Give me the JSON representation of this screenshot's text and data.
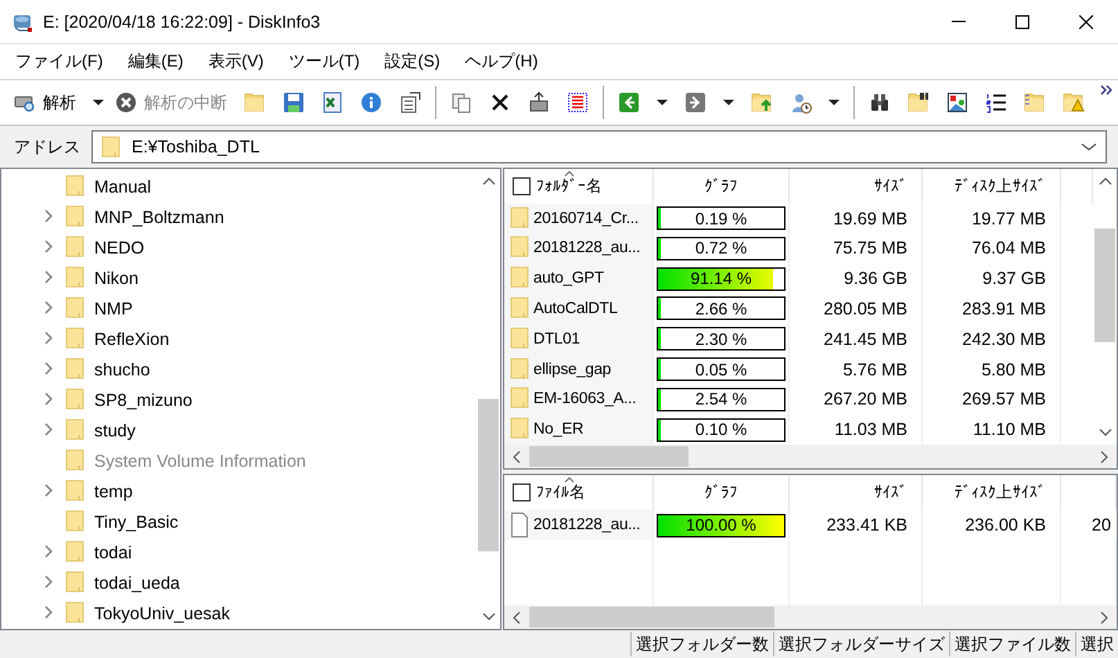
{
  "window": {
    "title": "E: [2020/04/18 16:22:09] - DiskInfo3"
  },
  "menu": [
    "ファイル(F)",
    "編集(E)",
    "表示(V)",
    "ツール(T)",
    "設定(S)",
    "ヘルプ(H)"
  ],
  "toolbar": {
    "buttons": [
      {
        "label": "解析",
        "disabled": false
      },
      {
        "label": "解析の中断",
        "disabled": true
      }
    ]
  },
  "address": {
    "label": "アドレス",
    "value": "E:¥Toshiba_DTL"
  },
  "tree": {
    "items": [
      {
        "label": "Manual",
        "expandable": false,
        "dimmed": false
      },
      {
        "label": "MNP_Boltzmann",
        "expandable": true,
        "dimmed": false
      },
      {
        "label": "NEDO",
        "expandable": true,
        "dimmed": false
      },
      {
        "label": "Nikon",
        "expandable": true,
        "dimmed": false
      },
      {
        "label": "NMP",
        "expandable": true,
        "dimmed": false
      },
      {
        "label": "RefleXion",
        "expandable": true,
        "dimmed": false
      },
      {
        "label": "shucho",
        "expandable": true,
        "dimmed": false
      },
      {
        "label": "SP8_mizuno",
        "expandable": true,
        "dimmed": false
      },
      {
        "label": "study",
        "expandable": true,
        "dimmed": false
      },
      {
        "label": "System Volume Information",
        "expandable": false,
        "dimmed": true
      },
      {
        "label": "temp",
        "expandable": true,
        "dimmed": false
      },
      {
        "label": "Tiny_Basic",
        "expandable": false,
        "dimmed": false
      },
      {
        "label": "todai",
        "expandable": true,
        "dimmed": false
      },
      {
        "label": "todai_ueda",
        "expandable": true,
        "dimmed": false
      },
      {
        "label": "TokyoUniv_uesak",
        "expandable": true,
        "dimmed": false
      }
    ]
  },
  "folders": {
    "select_all_checked": false,
    "columns": [
      "ﾌｫﾙﾀﾞｰ名",
      "ｸﾞﾗﾌ",
      "ｻｲｽﾞ",
      "ﾃﾞｨｽｸ上ｻｲｽﾞ"
    ],
    "rows": [
      {
        "name": "20160714_Cr...",
        "level": 0.0019,
        "percent": "0.19 %",
        "size": "19.69 MB",
        "disk_size": "19.77 MB"
      },
      {
        "name": "20181228_au...",
        "level": 0.0072,
        "percent": "0.72 %",
        "size": "75.75 MB",
        "disk_size": "76.04 MB"
      },
      {
        "name": "auto_GPT",
        "level": 0.9114,
        "percent": "91.14 %",
        "size": "9.36 GB",
        "disk_size": "9.37 GB"
      },
      {
        "name": "AutoCalDTL",
        "level": 0.0266,
        "percent": "2.66 %",
        "size": "280.05 MB",
        "disk_size": "283.91 MB"
      },
      {
        "name": "DTL01",
        "level": 0.023,
        "percent": "2.30 %",
        "size": "241.45 MB",
        "disk_size": "242.30 MB"
      },
      {
        "name": "ellipse_gap",
        "level": 0.0005,
        "percent": "0.05 %",
        "size": "5.76 MB",
        "disk_size": "5.80 MB"
      },
      {
        "name": "EM-16063_A...",
        "level": 0.0254,
        "percent": "2.54 %",
        "size": "267.20 MB",
        "disk_size": "269.57 MB"
      },
      {
        "name": "No_ER",
        "level": 0.001,
        "percent": "0.10 %",
        "size": "11.03 MB",
        "disk_size": "11.10 MB"
      }
    ]
  },
  "files": {
    "select_all_checked": false,
    "columns": [
      "ﾌｧｲﾙ名",
      "ｸﾞﾗﾌ",
      "ｻｲｽﾞ",
      "ﾃﾞｨｽｸ上ｻｲｽﾞ"
    ],
    "rows": [
      {
        "name": "20181228_au...",
        "level": 1,
        "percent": "100.00 %",
        "size": "233.41 KB",
        "disk_size": "236.00 KB",
        "column_5": "20"
      }
    ]
  },
  "status_bar": [
    "選択フォルダー数",
    "選択フォルダーサイズ",
    "選択ファイル数",
    "選択"
  ]
}
